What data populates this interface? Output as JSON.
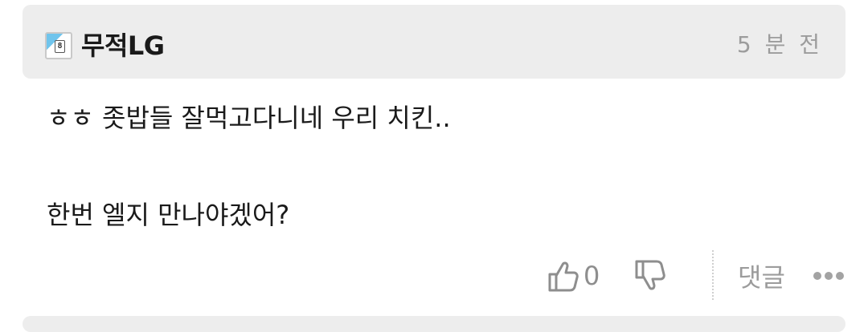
{
  "comment": {
    "nickname": "무적LG",
    "level_icon": "level-badge-icon",
    "time": "5 분 전",
    "body_line1": "ㅎㅎ 좃밥들 잘먹고다니네 우리 치킨..",
    "body_line2": "한번 엘지 만나야겠어?"
  },
  "actions": {
    "like_icon": "thumbs-up-icon",
    "like_count": "0",
    "dislike_icon": "thumbs-down-icon",
    "reply_label": "댓글",
    "more_icon": "more-dots-icon"
  },
  "colors": {
    "header_bg": "#ededed",
    "muted_text": "#9c9c9c",
    "icon": "#8e8e8e",
    "badge_accent": "#6fc4ec"
  }
}
